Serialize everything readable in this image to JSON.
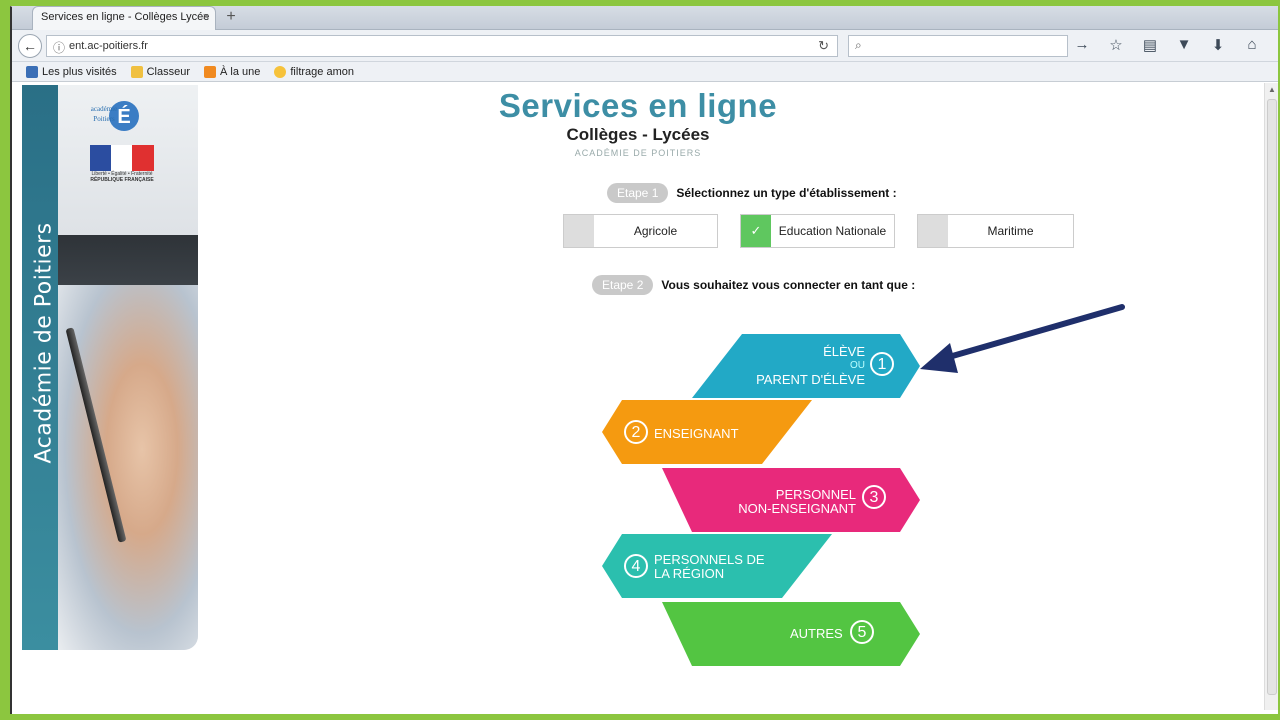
{
  "browser": {
    "tab_title": "Services en ligne - Collèges Lycée",
    "tab_close": "×",
    "new_tab": "+",
    "url": "ent.ac-poitiers.fr",
    "bookmarks": [
      {
        "label": "Les plus visités",
        "color": "#3b6fb6"
      },
      {
        "label": "Classeur",
        "color": "#f0c040"
      },
      {
        "label": "À la une",
        "color": "#f08a20"
      },
      {
        "label": "filtrage amon",
        "color": "#f6c23a"
      }
    ]
  },
  "side": {
    "vertical_text": "Académie de Poitiers",
    "logo_lines": [
      "académie",
      "Poitiers"
    ],
    "rf_text": "Liberté • Égalité • Fraternité",
    "rf_name": "RÉPUBLIQUE FRANÇAISE"
  },
  "header": {
    "title": "Services en ligne",
    "subtitle": "Collèges - Lycées",
    "academy": "ACADÉMIE DE POITIERS"
  },
  "step1": {
    "badge": "Etape 1",
    "text": "Sélectionnez un type d'établissement :",
    "options": [
      {
        "label": "Agricole",
        "selected": false
      },
      {
        "label": "Education Nationale",
        "selected": true,
        "check": "✓"
      },
      {
        "label": "Maritime",
        "selected": false
      }
    ]
  },
  "step2": {
    "badge": "Etape 2",
    "text": "Vous souhaitez vous connecter en tant que :"
  },
  "roles": [
    {
      "num": "1",
      "line1": "ÉLÈVE",
      "ou": "OU",
      "line2": "PARENT D'ÉLÈVE",
      "color": "#22a9c6"
    },
    {
      "num": "2",
      "line1": "ENSEIGNANT",
      "color": "#f59a10"
    },
    {
      "num": "3",
      "line1": "PERSONNEL",
      "line2": "NON-ENSEIGNANT",
      "color": "#e8297b"
    },
    {
      "num": "4",
      "line1": "PERSONNELS DE",
      "line2": "LA RÉGION",
      "color": "#2bbfae"
    },
    {
      "num": "5",
      "line1": "AUTRES",
      "color": "#53c542"
    }
  ]
}
